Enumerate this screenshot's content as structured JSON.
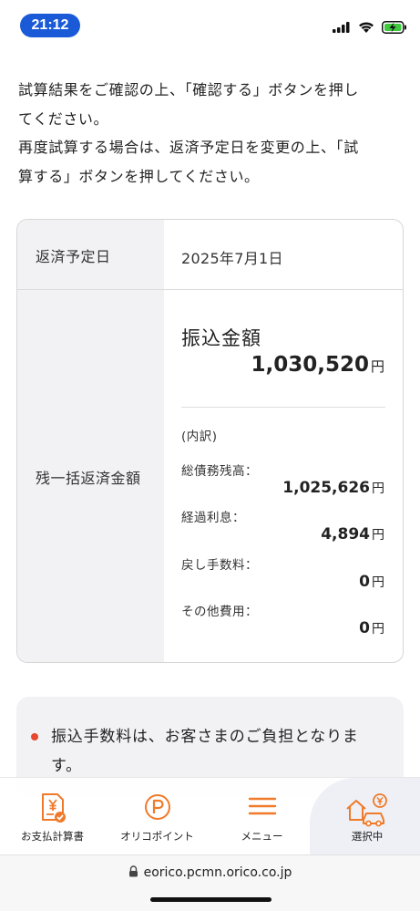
{
  "status": {
    "time": "21:12"
  },
  "intro": {
    "line1": "試算結果をご確認の上、「確認する」ボタンを押し",
    "line2": "てください。",
    "line3": "再度試算する場合は、返済予定日を変更の上、「試",
    "line4": "算する」ボタンを押してください。"
  },
  "table": {
    "due_date_label": "返済予定日",
    "due_date_value": "2025年7月1日",
    "lump_label": "残一括返済金額",
    "transfer_label": "振込金額",
    "transfer_amount": "1,030,520",
    "currency": "円",
    "breakdown_label": "(内訳)",
    "items": [
      {
        "label": "総債務残高：",
        "amount": "1,025,626"
      },
      {
        "label": "経過利息：",
        "amount": "4,894"
      },
      {
        "label": "戻し手数料：",
        "amount": "0"
      },
      {
        "label": "その他費用：",
        "amount": "0"
      }
    ]
  },
  "notice": {
    "line1": "振込手数料は、お客さまのご負担となりま",
    "line2": "す。"
  },
  "nav": {
    "items": [
      {
        "label": "お支払計算書",
        "icon": "payment-statement-icon"
      },
      {
        "label": "オリコポイント",
        "icon": "orico-point-icon"
      },
      {
        "label": "メニュー",
        "icon": "menu-icon"
      },
      {
        "label": "選択中",
        "icon": "home-car-icon"
      }
    ],
    "accent": "#f07a2a"
  },
  "browser": {
    "url": "eorico.pcmn.orico.co.jp"
  }
}
